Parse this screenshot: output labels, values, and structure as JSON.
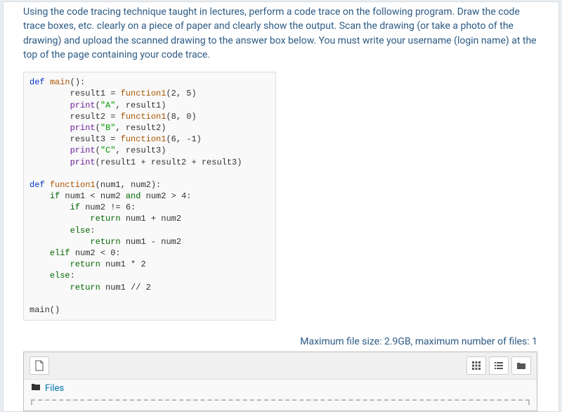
{
  "instructions": "Using the code tracing technique taught in lectures, perform a code trace on the following program. Draw the code trace boxes, etc. clearly on a piece of paper and clearly show the output. Scan the drawing (or take a photo of the drawing) and upload the scanned drawing to the answer box below. You must write your username (login name) at the top of the page containing your code trace.",
  "code": {
    "l1_def": "def",
    "l1_name": "main",
    "l1_rest": "():",
    "l2a": "        result1 = ",
    "l2b": "function1",
    "l2c": "(2, 5)",
    "l3a": "        ",
    "l3b": "print",
    "l3c": "(",
    "l3d": "\"A\"",
    "l3e": ", result1)",
    "l4a": "        result2 = ",
    "l4b": "function1",
    "l4c": "(8, 0)",
    "l5a": "        ",
    "l5b": "print",
    "l5c": "(",
    "l5d": "\"B\"",
    "l5e": ", result2)",
    "l6a": "        result3 = ",
    "l6b": "function1",
    "l6c": "(6, -1)",
    "l7a": "        ",
    "l7b": "print",
    "l7c": "(",
    "l7d": "\"C\"",
    "l7e": ", result3)",
    "l8a": "        ",
    "l8b": "print",
    "l8c": "(result1 + result2 + result3)",
    "l10_def": "def",
    "l10_name": "function1",
    "l10_rest": "(num1, num2):",
    "l11a": "    ",
    "l11b": "if",
    "l11c": " num1 < num2 ",
    "l11d": "and",
    "l11e": " num2 > 4:",
    "l12a": "        ",
    "l12b": "if",
    "l12c": " num2 != 6:",
    "l13a": "            ",
    "l13b": "return",
    "l13c": " num1 + num2",
    "l14a": "        ",
    "l14b": "else",
    "l14c": ":",
    "l15a": "            ",
    "l15b": "return",
    "l15c": " num1 - num2",
    "l16a": "    ",
    "l16b": "elif",
    "l16c": " num2 < 0:",
    "l17a": "        ",
    "l17b": "return",
    "l17c": " num1 * 2",
    "l18a": "    ",
    "l18b": "else",
    "l18c": ":",
    "l19a": "        ",
    "l19b": "return",
    "l19c": " num1 // 2",
    "l21": "main()"
  },
  "limits": "Maximum file size: 2.9GB, maximum number of files: 1",
  "breadcrumb": "Files"
}
